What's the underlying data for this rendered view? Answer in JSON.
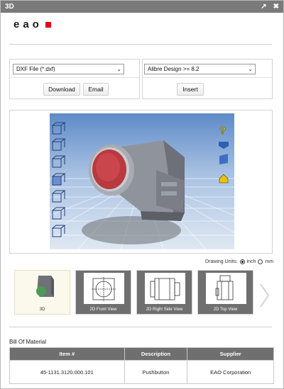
{
  "window": {
    "title": "3D"
  },
  "logo": {
    "text": "eao"
  },
  "formats": {
    "file_format": "DXF File (*.dxf)",
    "cad_format": "Alibre Design >= 8.2"
  },
  "actions": {
    "download": "Download",
    "email": "Email",
    "insert": "Insert"
  },
  "viewer": {
    "left_tool_icons": [
      "view-cube-icon",
      "view-cube-icon",
      "view-cube-icon",
      "view-cube-icon",
      "view-cube-icon",
      "view-cube-icon",
      "view-cube-icon"
    ],
    "right_tool_icons": [
      "help-icon",
      "rotate-icon",
      "cube-shade-icon",
      "home-icon"
    ],
    "help_glyph": "?"
  },
  "units": {
    "label": "Drawing Units:",
    "options": [
      "inch",
      "mm"
    ],
    "selected": "inch"
  },
  "thumbnails": [
    {
      "label": "3D",
      "active": true
    },
    {
      "label": "2D Front View",
      "active": false
    },
    {
      "label": "2D Right Side View",
      "active": false
    },
    {
      "label": "2D Top View",
      "active": false
    }
  ],
  "bom": {
    "title": "Bill Of Material",
    "headers": [
      "Item #",
      "Description",
      "Supplier"
    ],
    "rows": [
      [
        "45-1131.3120.000.101",
        "Pushbutton",
        "EAO Corporation"
      ]
    ]
  },
  "colors": {
    "brand_red": "#e30613",
    "titlebar": "#7a7a7a",
    "header_gray": "#6f6f6f"
  }
}
